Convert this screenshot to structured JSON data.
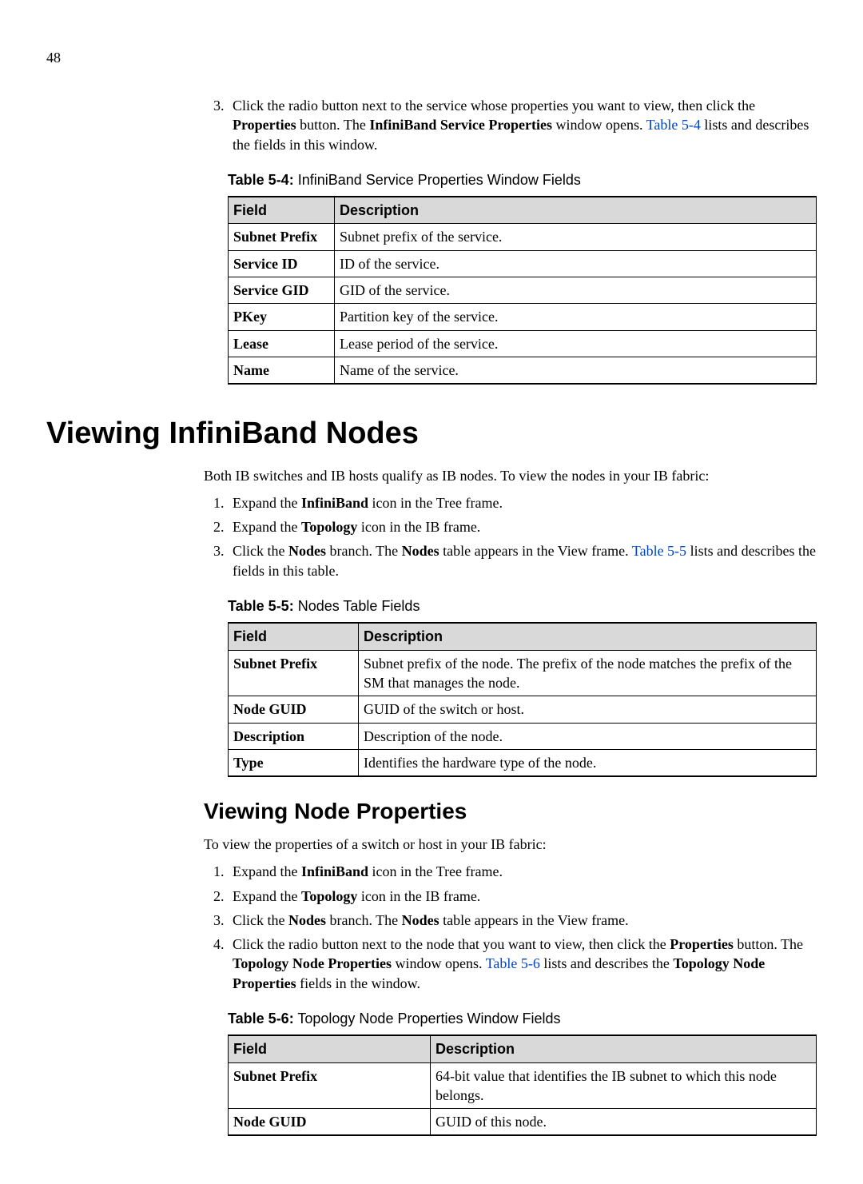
{
  "page_number": "48",
  "step3": {
    "prefix": "Click the radio button next to the service whose properties you want to view, then click the ",
    "bold1": "Properties",
    "mid1": " button. The ",
    "bold2": "InfiniBand Service Properties",
    "mid2": " window opens. ",
    "link": "Table 5-4",
    "suffix": " lists and describes the fields in this window."
  },
  "table1": {
    "caption_label": "Table 5-4:",
    "caption_text": " InfiniBand Service Properties Window Fields",
    "col_field": "Field",
    "col_desc": "Description",
    "rows": [
      {
        "f": "Subnet Prefix",
        "d": "Subnet prefix of the service."
      },
      {
        "f": "Service ID",
        "d": "ID of the service."
      },
      {
        "f": "Service GID",
        "d": "GID of the service."
      },
      {
        "f": "PKey",
        "d": "Partition key of the service."
      },
      {
        "f": "Lease",
        "d": "Lease period of the service."
      },
      {
        "f": "Name",
        "d": "Name of the service."
      }
    ]
  },
  "sec1": {
    "heading": "Viewing InfiniBand Nodes",
    "intro": "Both IB switches and IB hosts qualify as IB nodes. To view the nodes in your IB fabric:",
    "step1": {
      "pre": "Expand the ",
      "b": "InfiniBand",
      "post": " icon in the Tree frame."
    },
    "step2": {
      "pre": "Expand the ",
      "b": "Topology",
      "post": " icon in the IB frame."
    },
    "step3": {
      "pre": "Click the ",
      "b1": "Nodes",
      "mid1": " branch. The ",
      "b2": "Nodes",
      "mid2": " table appears in the View frame. ",
      "link": "Table 5-5",
      "post": " lists and describes the fields in this table."
    }
  },
  "table2": {
    "caption_label": "Table 5-5:",
    "caption_text": " Nodes Table Fields",
    "col_field": "Field",
    "col_desc": "Description",
    "rows": [
      {
        "f": "Subnet Prefix",
        "d": "Subnet prefix of the node. The prefix of the node matches the prefix of the SM that manages the node."
      },
      {
        "f": "Node GUID",
        "d": "GUID of the switch or host."
      },
      {
        "f": "Description",
        "d": "Description of the node."
      },
      {
        "f": "Type",
        "d": "Identifies the hardware type of the node."
      }
    ]
  },
  "sec2": {
    "heading": "Viewing Node Properties",
    "intro": "To view the properties of a switch or host in your IB fabric:",
    "step1": {
      "pre": "Expand the ",
      "b": "InfiniBand",
      "post": " icon in the Tree frame."
    },
    "step2": {
      "pre": "Expand the ",
      "b": "Topology",
      "post": " icon in the IB frame."
    },
    "step3": {
      "pre": "Click the ",
      "b1": "Nodes",
      "mid": " branch. The ",
      "b2": "Nodes",
      "post": " table appears in the View frame."
    },
    "step4": {
      "pre": "Click the radio button next to the node that you want to view, then click the ",
      "b1": "Properties",
      "mid1": " button. The ",
      "b2": "Topology Node Properties",
      "mid2": " window opens. ",
      "link": "Table 5-6",
      "mid3": " lists and describes the ",
      "b3": "Topology Node Properties",
      "post": " fields in the window."
    }
  },
  "table3": {
    "caption_label": "Table 5-6:",
    "caption_text": " Topology Node Properties Window Fields",
    "col_field": "Field",
    "col_desc": "Description",
    "rows": [
      {
        "f": "Subnet Prefix",
        "d": "64-bit value that identifies the IB subnet to which this node belongs."
      },
      {
        "f": "Node GUID",
        "d": "GUID of this node."
      }
    ]
  }
}
